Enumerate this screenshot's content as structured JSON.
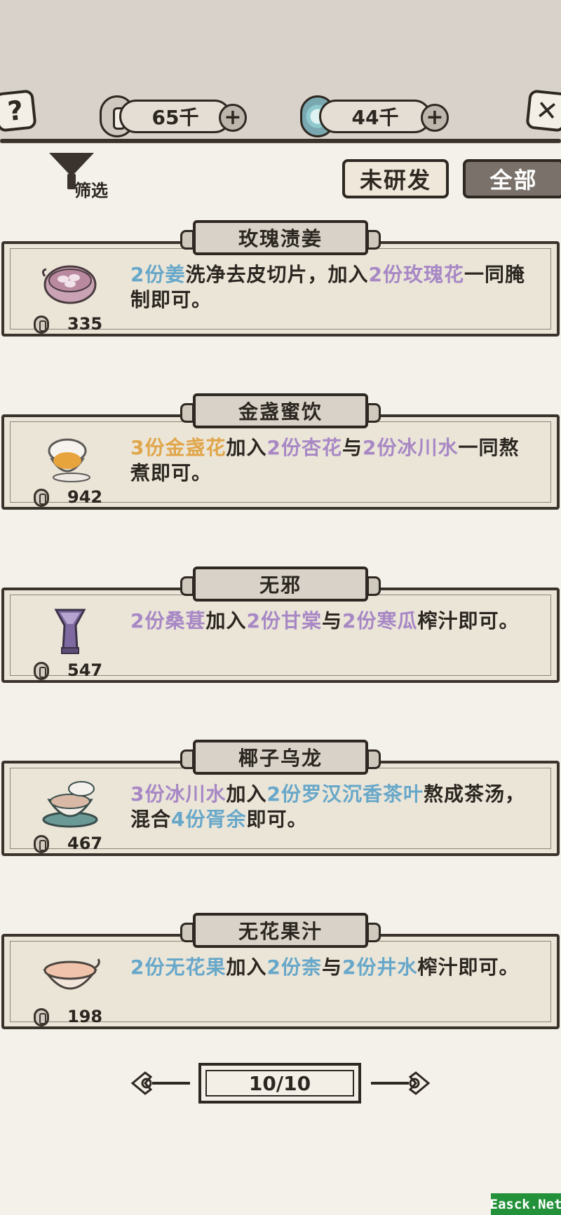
{
  "header": {
    "coins": "65千",
    "gems": "44千",
    "help_icon": "question-mark-icon",
    "close_icon": "close-x-icon"
  },
  "filter": {
    "label": "筛选",
    "icon": "funnel-icon"
  },
  "tabs": {
    "undeveloped": "未研发",
    "all": "全部",
    "active": "all"
  },
  "recipes": [
    {
      "title": "玫瑰渍姜",
      "icon": "pink-bowl-icon",
      "price": "335",
      "desc": [
        {
          "t": "2份姜",
          "c": "blue"
        },
        {
          "t": "洗净去皮切片，加入",
          "c": "plain"
        },
        {
          "t": "2份玫瑰花",
          "c": "purple"
        },
        {
          "t": "一同腌制即可。",
          "c": "plain"
        }
      ]
    },
    {
      "title": "金盏蜜饮",
      "icon": "teacup-icon",
      "price": "942",
      "desc": [
        {
          "t": "3份金盏花",
          "c": "orange"
        },
        {
          "t": "加入",
          "c": "plain"
        },
        {
          "t": "2份杏花",
          "c": "purple"
        },
        {
          "t": "与",
          "c": "plain"
        },
        {
          "t": "2份冰川水",
          "c": "purple"
        },
        {
          "t": "一同熬煮即可。",
          "c": "plain"
        }
      ]
    },
    {
      "title": "无邪",
      "icon": "purple-vase-icon",
      "price": "547",
      "desc": [
        {
          "t": "2份桑葚",
          "c": "purple"
        },
        {
          "t": "加入",
          "c": "plain"
        },
        {
          "t": "2份甘棠",
          "c": "purple"
        },
        {
          "t": "与",
          "c": "plain"
        },
        {
          "t": "2份寒瓜",
          "c": "purple"
        },
        {
          "t": "榨汁即可。",
          "c": "plain"
        }
      ]
    },
    {
      "title": "椰子乌龙",
      "icon": "teal-teacup-icon",
      "price": "467",
      "desc": [
        {
          "t": "3份冰川水",
          "c": "purple"
        },
        {
          "t": "加入",
          "c": "plain"
        },
        {
          "t": "2份罗汉沉香茶叶",
          "c": "blue"
        },
        {
          "t": "熬成茶汤，混合",
          "c": "plain"
        },
        {
          "t": "4份胥余",
          "c": "blue"
        },
        {
          "t": "即可。",
          "c": "plain"
        }
      ]
    },
    {
      "title": "无花果汁",
      "icon": "peach-bowl-icon",
      "price": "198",
      "desc": [
        {
          "t": "2份无花果",
          "c": "blue"
        },
        {
          "t": "加入",
          "c": "plain"
        },
        {
          "t": "2份柰",
          "c": "blue"
        },
        {
          "t": "与",
          "c": "plain"
        },
        {
          "t": "2份井水",
          "c": "blue"
        },
        {
          "t": "榨汁即可。",
          "c": "plain"
        }
      ]
    }
  ],
  "pager": {
    "label": "10/10"
  },
  "watermark": "Easck.Net",
  "colors": {
    "highlight_blue": "#67a7c9",
    "highlight_purple": "#a788c5",
    "highlight_orange": "#e0a64a",
    "ink": "#2e2822",
    "paper": "#f4f1ea"
  }
}
